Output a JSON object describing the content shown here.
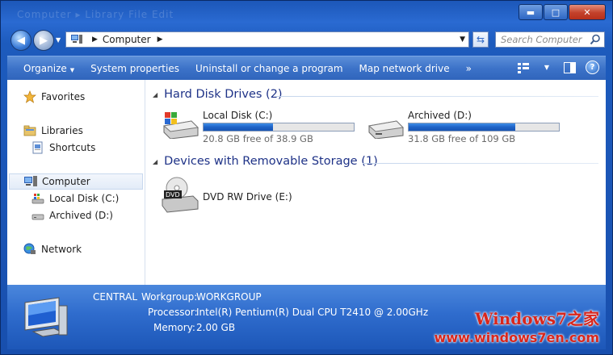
{
  "window": {
    "ghost_menu": "Computer ▸ Library   File   Edit",
    "controls": {
      "minimize": "▬",
      "maximize": "□",
      "close": "✕"
    }
  },
  "address": {
    "path": "Computer",
    "search_placeholder": "Search Computer"
  },
  "toolbar": {
    "organize": "Organize",
    "system_properties": "System properties",
    "uninstall": "Uninstall or change a program",
    "map_drive": "Map network drive",
    "more": "»"
  },
  "sidebar": {
    "favorites": "Favorites",
    "libraries": "Libraries",
    "shortcuts": "Shortcuts",
    "computer": "Computer",
    "local_disk": "Local Disk (C:)",
    "archived": "Archived (D:)",
    "network": "Network"
  },
  "groups": {
    "hard_disks": "Hard Disk Drives (2)",
    "removable": "Devices with Removable Storage (1)"
  },
  "drives": [
    {
      "name": "Local Disk (C:)",
      "free_text": "20.8 GB free of 38.9 GB",
      "used_fraction": 0.465
    },
    {
      "name": "Archived (D:)",
      "free_text": "31.8 GB free of 109 GB",
      "used_fraction": 0.71
    }
  ],
  "dvd": {
    "name": "DVD RW Drive (E:)",
    "badge": "DVD"
  },
  "details": {
    "computer_name": "CENTRAL",
    "workgroup_label": "Workgroup:",
    "workgroup": "WORKGROUP",
    "processor_label": "Processor:",
    "processor": "Intel(R) Pentium(R) Dual  CPU  T2410  @ 2.00GHz",
    "memory_label": "Memory:",
    "memory": "2.00 GB"
  },
  "watermark": {
    "brand": "Windows7之家",
    "url": "www.windows7en.com"
  },
  "colors": {
    "accent": "#2f6ccd",
    "group_text": "#1e3287",
    "watermark": "#d9261c"
  }
}
